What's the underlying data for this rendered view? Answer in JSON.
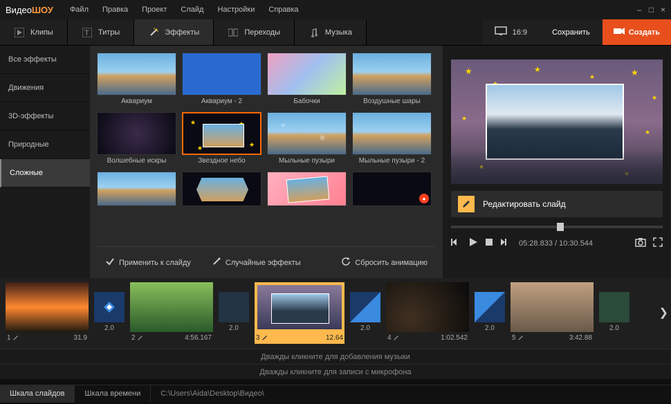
{
  "app": {
    "name_a": "Видео",
    "name_b": "ШОУ"
  },
  "menu": [
    "Файл",
    "Правка",
    "Проект",
    "Слайд",
    "Настройки",
    "Справка"
  ],
  "tabs": [
    {
      "label": "Клипы"
    },
    {
      "label": "Титры"
    },
    {
      "label": "Эффекты"
    },
    {
      "label": "Переходы"
    },
    {
      "label": "Музыка"
    }
  ],
  "ratio": "16:9",
  "save_label": "Сохранить",
  "create_label": "Создать",
  "categories": [
    "Все эффекты",
    "Движения",
    "3D-эффекты",
    "Природные",
    "Сложные"
  ],
  "effects": [
    {
      "name": "Аквариум"
    },
    {
      "name": "Аквариум - 2"
    },
    {
      "name": "Бабочки"
    },
    {
      "name": "Воздушные шары"
    },
    {
      "name": "Волшебные искры"
    },
    {
      "name": "Звездное небо"
    },
    {
      "name": "Мыльные пузыри"
    },
    {
      "name": "Мыльные пузыри - 2"
    }
  ],
  "fxbuttons": {
    "apply": "Применить к слайду",
    "random": "Случайные эффекты",
    "reset": "Сбросить анимацию"
  },
  "preview": {
    "edit_label": "Редактировать слайд",
    "time_cur": "05:28.833",
    "time_total": "10:30.544"
  },
  "timeline": [
    {
      "idx": "1",
      "dur": "31.9"
    },
    {
      "trans_dur": "2.0"
    },
    {
      "idx": "2",
      "dur": "4:56.167"
    },
    {
      "trans_dur": "2.0"
    },
    {
      "idx": "3",
      "dur": "12.64"
    },
    {
      "trans_dur": "2.0"
    },
    {
      "idx": "4",
      "dur": "1:02.542"
    },
    {
      "trans_dur": "2.0"
    },
    {
      "idx": "5",
      "dur": "3:42.88"
    },
    {
      "trans_dur": "2.0"
    }
  ],
  "hints": {
    "music": "Дважды кликните для добавления музыки",
    "mic": "Дважды кликните для записи с микрофона"
  },
  "status": {
    "tab_slides": "Шкала слайдов",
    "tab_time": "Шкала времени",
    "path": "C:\\Users\\Aida\\Desktop\\Видео\\"
  }
}
